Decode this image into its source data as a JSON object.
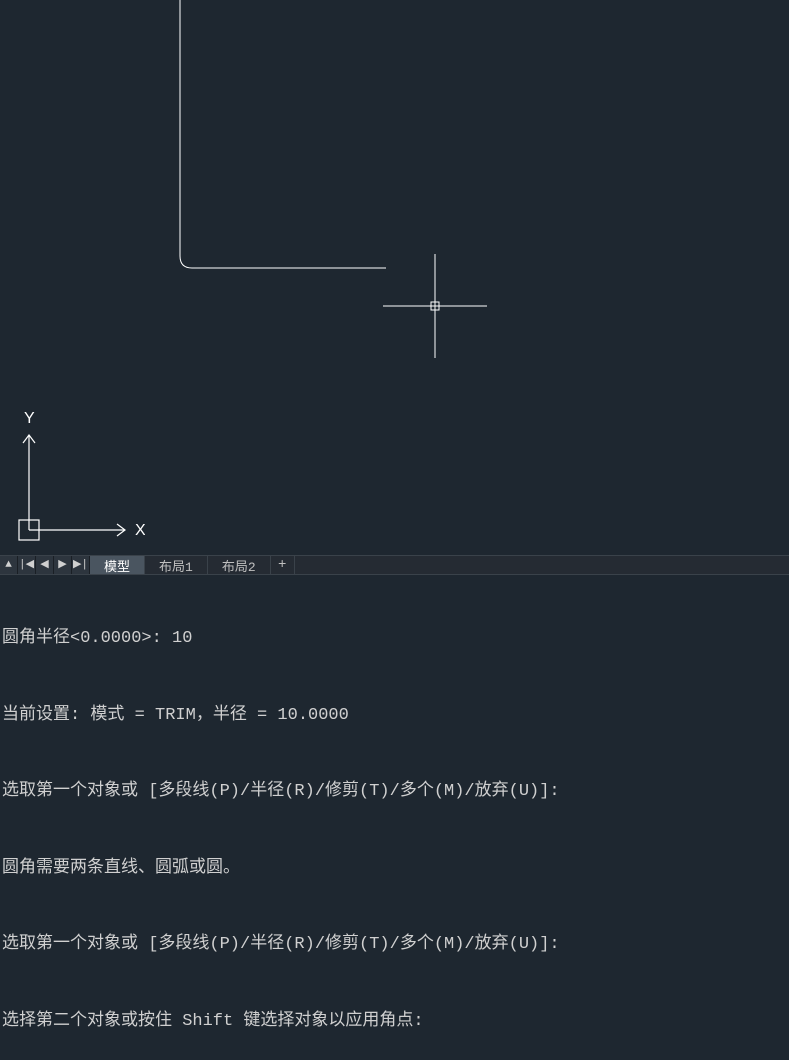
{
  "ucs": {
    "x_label": "X",
    "y_label": "Y"
  },
  "tabs": {
    "model": "模型",
    "layout1": "布局1",
    "layout2": "布局2",
    "add": "+"
  },
  "nav": {
    "up": "▲",
    "first": "|◀",
    "prev": "◀",
    "next": "▶",
    "last": "▶|"
  },
  "command": {
    "line1": "圆角半径<0.0000>: 10",
    "line2": "当前设置: 模式 = TRIM，半径 = 10.0000",
    "line3": "选取第一个对象或 [多段线(P)/半径(R)/修剪(T)/多个(M)/放弃(U)]:",
    "line4": "圆角需要两条直线、圆弧或圆。",
    "line5": "选取第一个对象或 [多段线(P)/半径(R)/修剪(T)/多个(M)/放弃(U)]:",
    "line6": "选择第二个对象或按住 Shift 键选择对象以应用角点:"
  }
}
